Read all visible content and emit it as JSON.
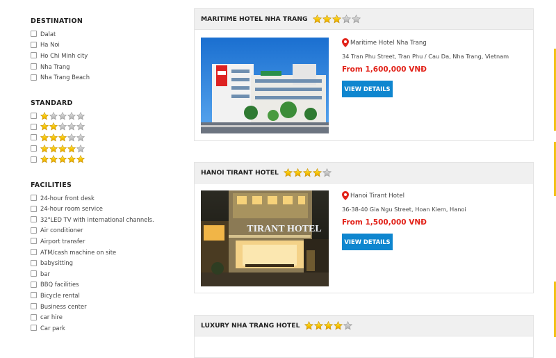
{
  "filters": {
    "destination": {
      "title": "DESTINATION",
      "options": [
        "Dalat",
        "Ha Noi",
        "Ho Chi Minh city",
        "Nha Trang",
        "Nha Trang Beach"
      ]
    },
    "standard": {
      "title": "STANDARD",
      "options": [
        1,
        2,
        3,
        4,
        5
      ],
      "max_stars": 5
    },
    "facilities": {
      "title": "FACILITIES",
      "options": [
        "24-hour front desk",
        "24-hour room service",
        "32\"LED TV with international channels.",
        "Air conditioner",
        "Airport transfer",
        "ATM/cash machine on site",
        "babysitting",
        "bar",
        "BBQ facilities",
        "Bicycle rental",
        "Business center",
        "car hire",
        "Car park"
      ]
    }
  },
  "hotels": [
    {
      "name": "MARITIME HOTEL NHA TRANG",
      "stars": 3,
      "location_name": "Maritime Hotel Nha Trang",
      "address": "34 Tran Phu Street, Tran Phu / Cau Da, Nha Trang, Vietnam",
      "price": "From 1,600,000 VNĐ",
      "button_label": "VIEW DETAILS"
    },
    {
      "name": "HANOI TIRANT HOTEL",
      "stars": 4,
      "location_name": "Hanoi Tirant Hotel",
      "address": "36-38-40 Gia Ngu Street, Hoan Kiem, Hanoi",
      "price": "From 1,500,000 VNĐ",
      "button_label": "VIEW DETAILS",
      "photo_sign": "TIRANT HOTEL"
    },
    {
      "name": "LUXURY NHA TRANG HOTEL",
      "stars": 4
    }
  ],
  "colors": {
    "accent": "#0f86cf",
    "price": "#e2231a",
    "star": "#f7c400",
    "star_empty": "#c7c7c7",
    "side_marker": "#f2c21b"
  }
}
